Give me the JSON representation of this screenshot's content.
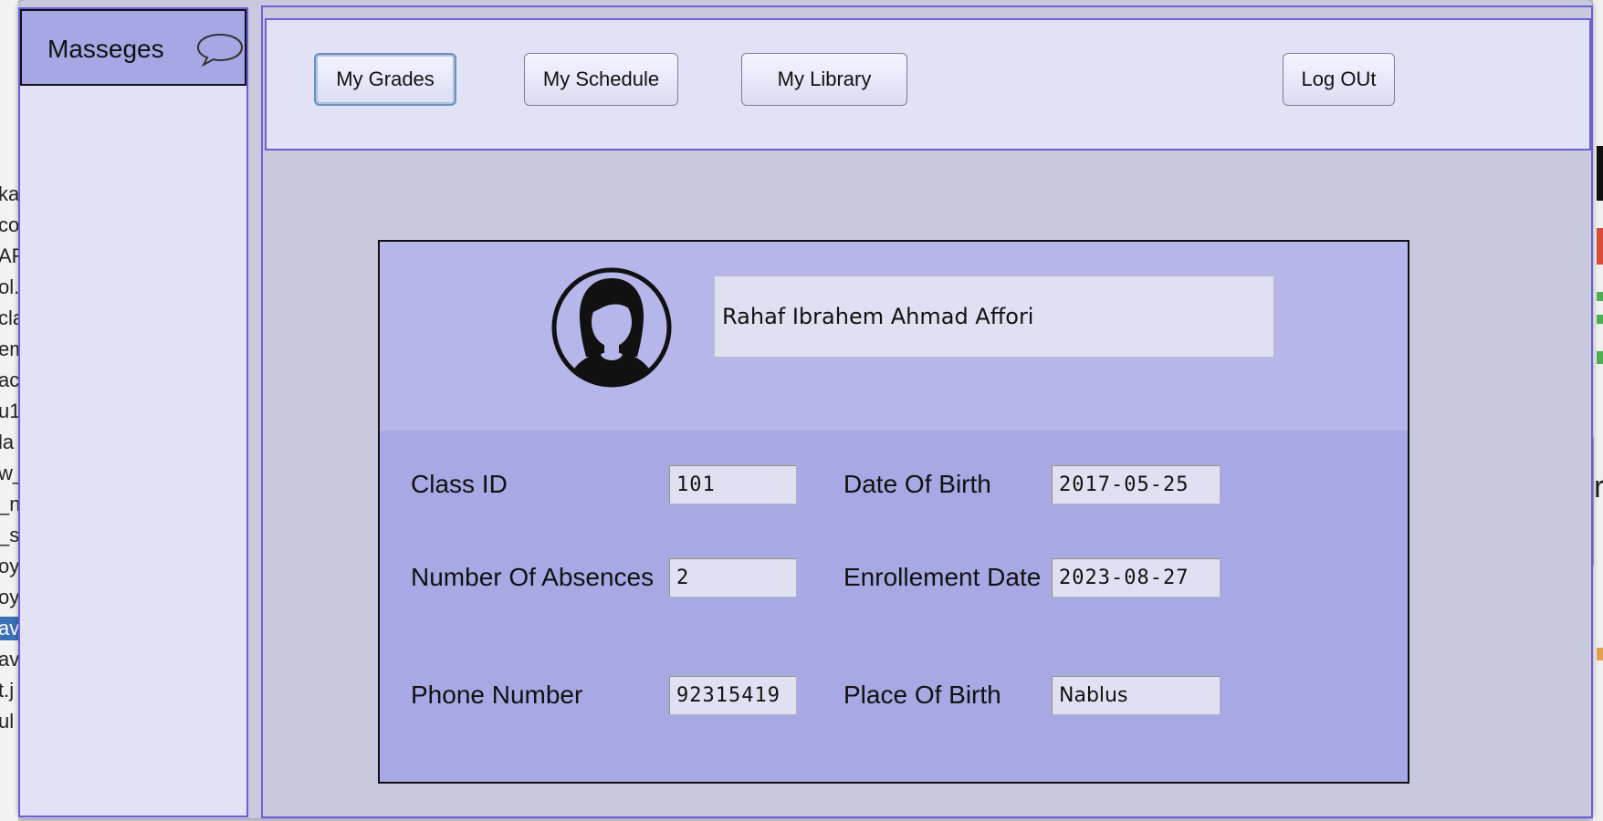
{
  "background": {
    "left_fragments": [
      "ka",
      "co",
      "AR",
      "ol.j",
      "cla",
      "em",
      "ac",
      "u1",
      "la",
      "w_",
      "_n",
      "_s",
      "oyc",
      "oyc",
      "av",
      "ava",
      "t.j",
      "ul"
    ],
    "right_fragment": "r"
  },
  "sidebar": {
    "messages_label": "Masseges",
    "messages_icon": "speech-bubble-icon"
  },
  "navbar": {
    "my_grades": "My Grades",
    "my_schedule": "My Schedule",
    "my_library": "My Library",
    "log_out": "Log OUt"
  },
  "profile": {
    "avatar_icon": "female-user-avatar-icon",
    "full_name": "Rahaf Ibrahem Ahmad Affori",
    "fields": {
      "class_id": {
        "label": "Class ID",
        "value": "101"
      },
      "date_of_birth": {
        "label": "Date Of Birth",
        "value": "2017-05-25"
      },
      "absences": {
        "label": "Number Of Absences",
        "value": "2"
      },
      "enrollment_date": {
        "label": "Enrollement Date",
        "value": "2023-08-27"
      },
      "phone": {
        "label": "Phone Number",
        "value": "92315419"
      },
      "place_of_birth": {
        "label": "Place Of Birth",
        "value": "Nablus"
      }
    }
  },
  "colors": {
    "window_bg": "#c9c9de",
    "panel_bg": "#e2e2f7",
    "border_accent": "#6a60d8",
    "card_top": "#b6b6ea",
    "card_bottom": "#a8a8e4",
    "messages_header": "#a7a7e6"
  }
}
